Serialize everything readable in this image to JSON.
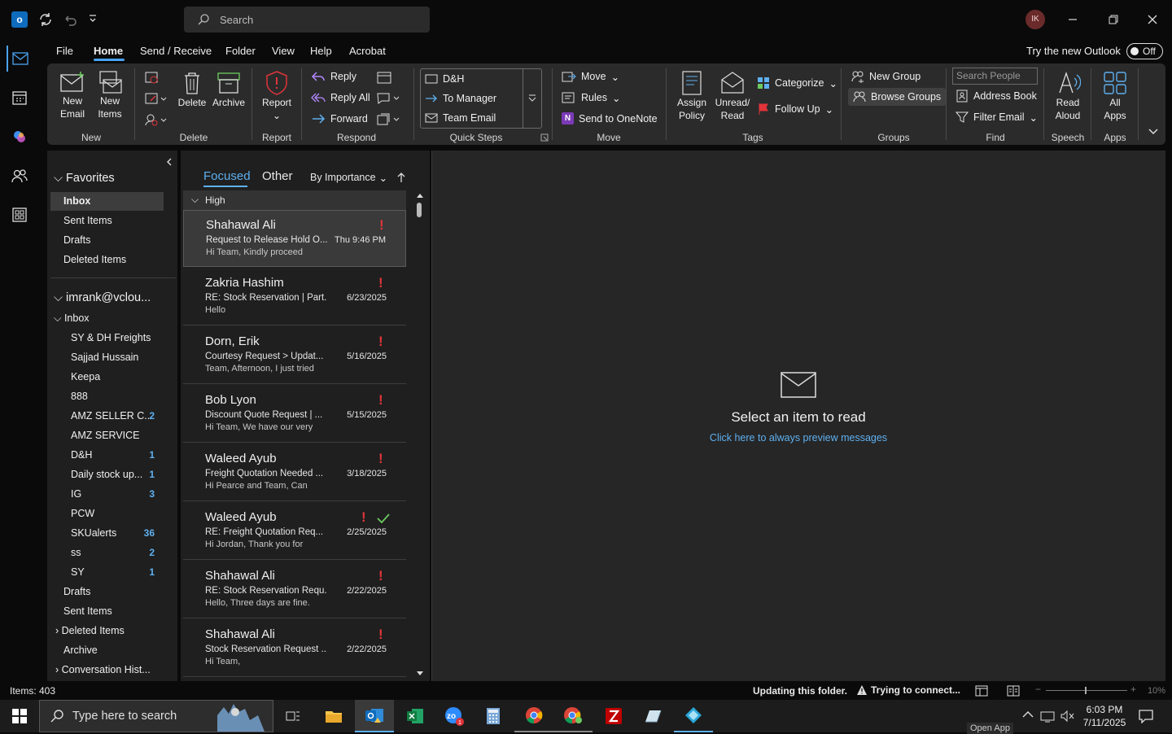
{
  "window": {
    "search_placeholder": "Search",
    "avatar": "IK"
  },
  "menu": {
    "file": "File",
    "home": "Home",
    "send_receive": "Send / Receive",
    "folder": "Folder",
    "view": "View",
    "help": "Help",
    "acrobat": "Acrobat",
    "try_new": "Try the new Outlook",
    "toggle": "Off"
  },
  "ribbon": {
    "new_email": [
      "New",
      "Email"
    ],
    "new_items": [
      "New",
      "Items"
    ],
    "delete": "Delete",
    "archive": "Archive",
    "report": "Report",
    "reply": "Reply",
    "reply_all": "Reply All",
    "forward": "Forward",
    "qs_1": "D&H",
    "qs_2": "To Manager",
    "qs_3": "Team Email",
    "move": "Move",
    "rules": "Rules",
    "onenote": "Send to OneNote",
    "assign_policy": [
      "Assign",
      "Policy"
    ],
    "unread_read": [
      "Unread/",
      "Read"
    ],
    "categorize": "Categorize",
    "follow_up": "Follow Up",
    "new_group": "New Group",
    "browse_groups": "Browse Groups",
    "search_people": "Search People",
    "address_book": "Address Book",
    "filter_email": "Filter Email",
    "read_aloud": [
      "Read",
      "Aloud"
    ],
    "all_apps": [
      "All",
      "Apps"
    ],
    "groups": {
      "new": "New",
      "delete": "Delete",
      "report": "Report",
      "respond": "Respond",
      "quick_steps": "Quick Steps",
      "move": "Move",
      "tags": "Tags",
      "groups": "Groups",
      "find": "Find",
      "speech": "Speech",
      "apps": "Apps"
    }
  },
  "folders": {
    "favorites": "Favorites",
    "fav_items": [
      "Inbox",
      "Sent Items",
      "Drafts",
      "Deleted Items"
    ],
    "account": "imrank@vclou...",
    "inbox": "Inbox",
    "subfolders": [
      {
        "name": "SY & DH Freights",
        "count": ""
      },
      {
        "name": "Sajjad Hussain",
        "count": ""
      },
      {
        "name": "Keepa",
        "count": ""
      },
      {
        "name": "888",
        "count": ""
      },
      {
        "name": "AMZ SELLER C...",
        "count": "2"
      },
      {
        "name": "AMZ SERVICE",
        "count": ""
      },
      {
        "name": "D&H",
        "count": "1"
      },
      {
        "name": "Daily stock up...",
        "count": "1"
      },
      {
        "name": "IG",
        "count": "3"
      },
      {
        "name": "PCW",
        "count": ""
      },
      {
        "name": "SKUalerts",
        "count": "36"
      },
      {
        "name": "ss",
        "count": "2"
      },
      {
        "name": "SY",
        "count": "1"
      }
    ],
    "other": [
      "Drafts",
      "Sent Items",
      "Deleted Items",
      "Archive",
      "Conversation Hist..."
    ]
  },
  "list": {
    "tab_focused": "Focused",
    "tab_other": "Other",
    "sort": "By Importance",
    "group": "High",
    "messages": [
      {
        "sender": "Shahawal Ali",
        "subject": "Request to Release Hold O...",
        "date": "Thu 9:46 PM",
        "preview": "Hi Team,  Kindly proceed"
      },
      {
        "sender": "Zakria Hashim",
        "subject": "RE: Stock Reservation | Part...",
        "date": "6/23/2025",
        "preview": "Hello"
      },
      {
        "sender": "Dorn, Erik",
        "subject": "Courtesy Request > Updat...",
        "date": "5/16/2025",
        "preview": "Team,  Afternoon, I just tried"
      },
      {
        "sender": "Bob Lyon",
        "subject": "Discount Quote Request | ...",
        "date": "5/15/2025",
        "preview": "Hi Team,  We have our very"
      },
      {
        "sender": "Waleed Ayub",
        "subject": "Freight Quotation Needed ...",
        "date": "3/18/2025",
        "preview": "Hi Pearce and Team,  Can"
      },
      {
        "sender": "Waleed Ayub",
        "subject": "RE: Freight Quotation Req...",
        "date": "2/25/2025",
        "preview": "Hi Jordan,  Thank you for"
      },
      {
        "sender": "Shahawal Ali",
        "subject": "RE: Stock Reservation Requ...",
        "date": "2/22/2025",
        "preview": "Hello,  Three days are fine."
      },
      {
        "sender": "Shahawal Ali",
        "subject": "Stock Reservation Request ...",
        "date": "2/22/2025",
        "preview": "Hi Team,"
      }
    ]
  },
  "reading": {
    "title": "Select an item to read",
    "link": "Click here to always preview messages"
  },
  "status": {
    "items": "Items: 403",
    "updating": "Updating this folder.",
    "connecting": "Trying to connect...",
    "zoom": "10%"
  },
  "taskbar": {
    "search": "Type here to search",
    "time": "6:03 PM",
    "date": "7/11/2025",
    "tooltip": "Open App"
  },
  "colors": {
    "accent": "#4aa3f0",
    "important": "#e0343a"
  }
}
